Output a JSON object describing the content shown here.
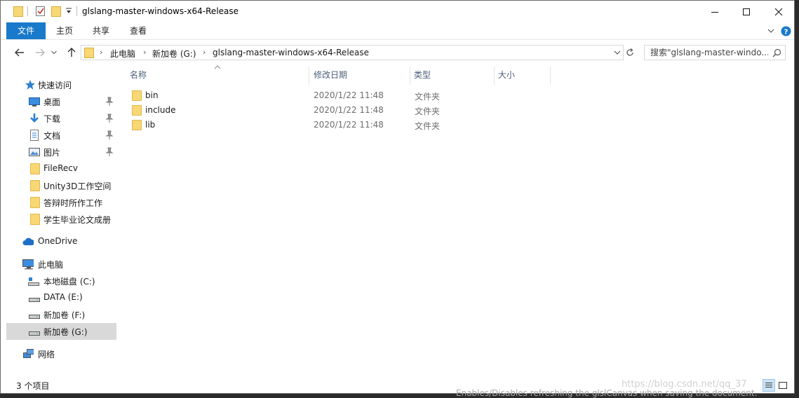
{
  "window": {
    "title": "glslang-master-windows-x64-Release"
  },
  "ribbon": {
    "tabs": [
      "文件",
      "主页",
      "共享",
      "查看"
    ]
  },
  "address": {
    "crumbs": [
      "此电脑",
      "新加卷 (G:)",
      "glslang-master-windows-x64-Release"
    ]
  },
  "search": {
    "placeholder": "搜索\"glslang-master-windo..."
  },
  "navpane": {
    "quick_access": "快速访问",
    "pinned": [
      "桌面",
      "下载",
      "文档",
      "图片"
    ],
    "folders": [
      "FileRecv",
      "Unity3D工作空间",
      "答辩时所作工作",
      "学生毕业论文成册"
    ],
    "onedrive": "OneDrive",
    "this_pc": "此电脑",
    "drives": [
      "本地磁盘 (C:)",
      "DATA (E:)",
      "新加卷 (F:)",
      "新加卷 (G:)"
    ],
    "network": "网络"
  },
  "columns": {
    "name": "名称",
    "date": "修改日期",
    "type": "类型",
    "size": "大小"
  },
  "files": [
    {
      "name": "bin",
      "date": "2020/1/22 11:48",
      "type": "文件夹"
    },
    {
      "name": "include",
      "date": "2020/1/22 11:48",
      "type": "文件夹"
    },
    {
      "name": "lib",
      "date": "2020/1/22 11:48",
      "type": "文件夹"
    }
  ],
  "status": {
    "count": "3 个项目"
  },
  "overlay": {
    "tip": "Enables/Disables refreshing the glslCanvas when saving the document.",
    "watermark": "https://blog.csdn.net/qq_37"
  },
  "colors": {
    "accent": "#1979ca",
    "folder": "#f8d775",
    "selected": "#d9d9d9"
  }
}
